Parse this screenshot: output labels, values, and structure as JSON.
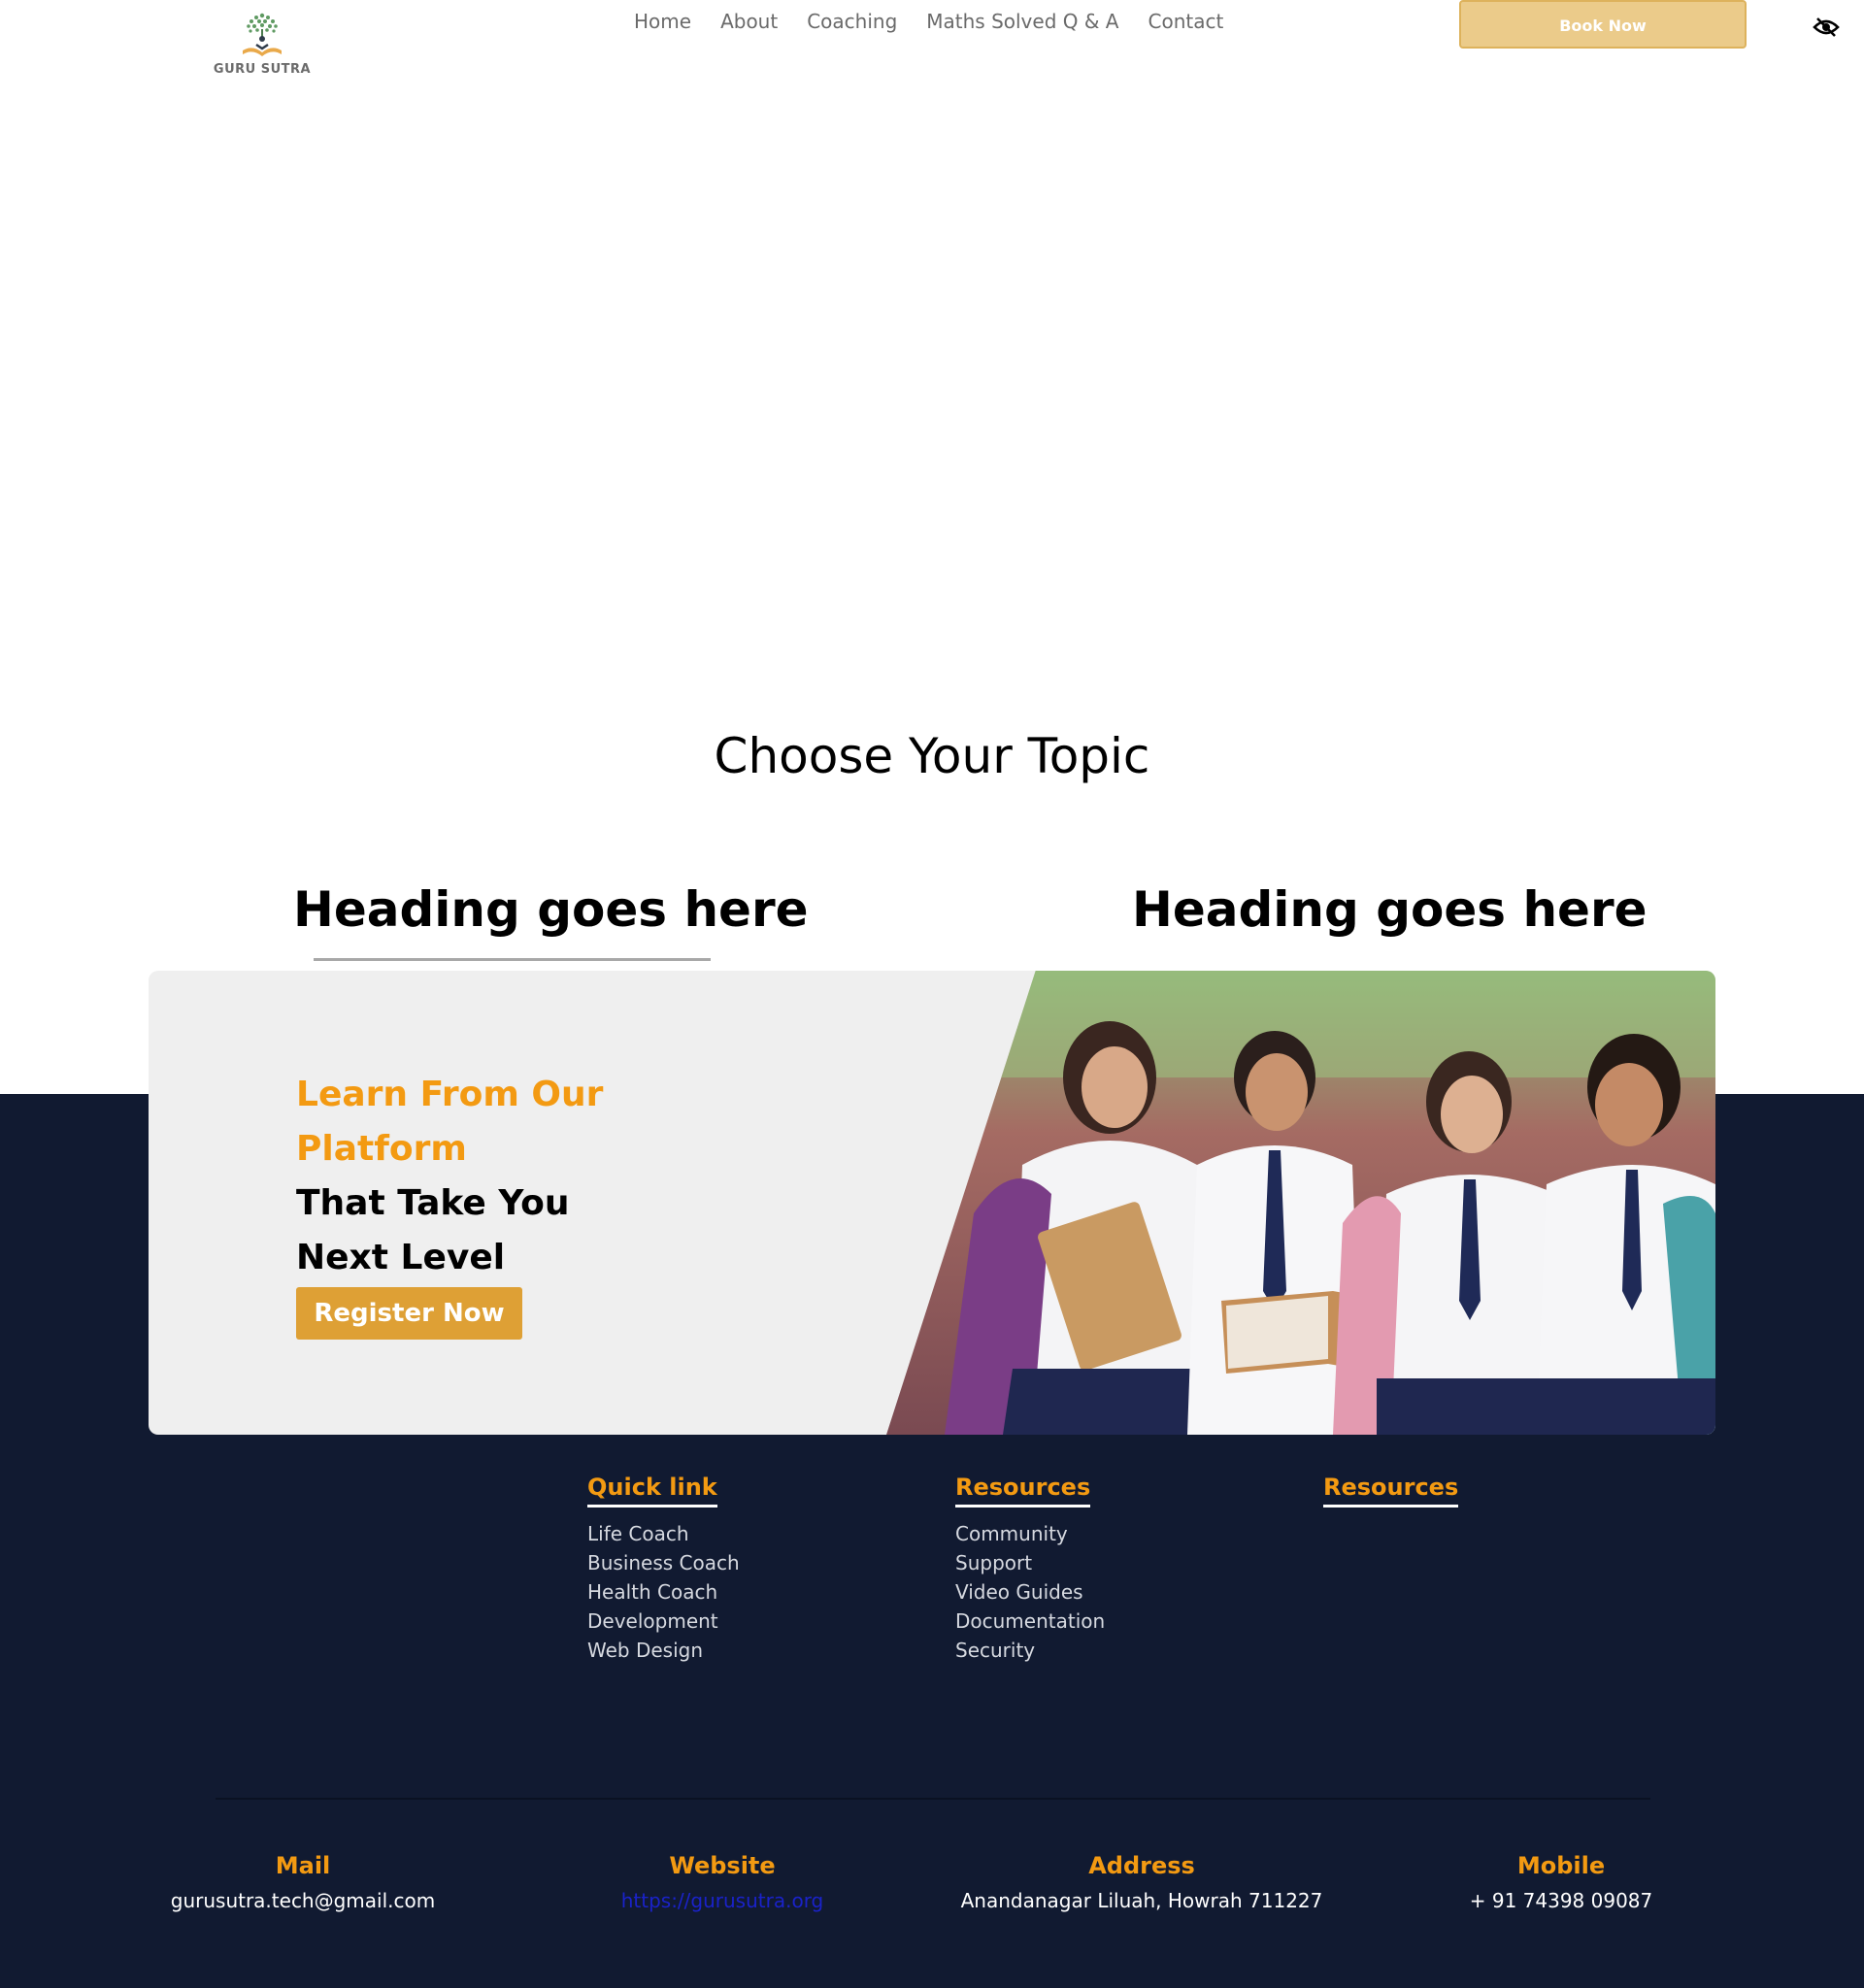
{
  "header": {
    "logo_text": "GURU SUTRA",
    "nav": [
      "Home",
      "About",
      "Coaching",
      "Maths Solved Q & A",
      "Contact"
    ],
    "book_label": "Book Now"
  },
  "topic": {
    "title": "Choose Your Topic",
    "heading_left": "Heading goes here",
    "heading_right": "Heading goes here"
  },
  "banner": {
    "line1": "Learn From Our",
    "line2": "Platform",
    "line3": "That Take You",
    "line4": "Next Level",
    "register_label": "Register Now"
  },
  "footer": {
    "columns": [
      {
        "title": "Quick link",
        "items": [
          "Life Coach",
          "Business Coach",
          "Health Coach",
          "Development",
          "Web Design"
        ]
      },
      {
        "title": "Resources",
        "items": [
          "Community",
          "Support",
          "Video Guides",
          "Documentation",
          "Security"
        ]
      },
      {
        "title": "Resources",
        "items": []
      }
    ],
    "contacts": [
      {
        "label": "Mail",
        "value": "gurusutra.tech@gmail.com"
      },
      {
        "label": "Website",
        "value": "https://gurusutra.org"
      },
      {
        "label": "Address",
        "value": "Anandanagar Liluah, Howrah 711227"
      },
      {
        "label": "Mobile",
        "value": "+ 91 74398 09087"
      }
    ]
  },
  "colors": {
    "accent_orange": "#f39a12",
    "button_gold": "#dea035",
    "book_button": "#ebcb8a",
    "footer_bg": "#111a31"
  },
  "icons": [
    "logo-tree-icon",
    "eye-slash-icon"
  ]
}
